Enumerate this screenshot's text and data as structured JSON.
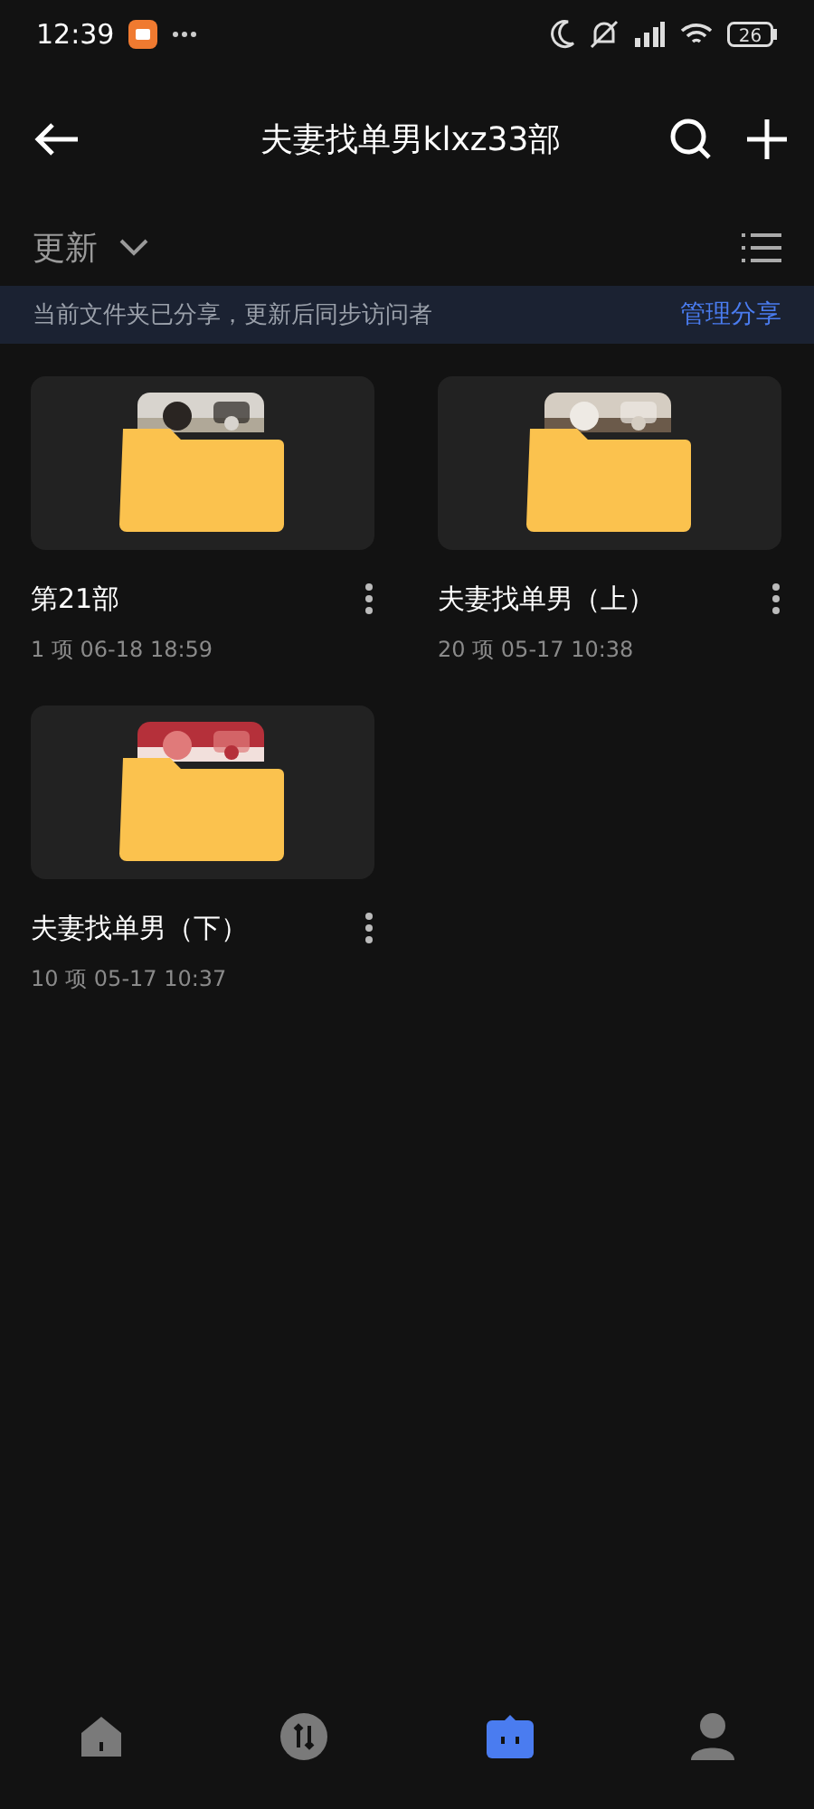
{
  "status_bar": {
    "time": "12:39",
    "battery": "26"
  },
  "header": {
    "title": "夫妻找单男klxz33部"
  },
  "sort": {
    "label": "更新"
  },
  "share_banner": {
    "message": "当前文件夹已分享，更新后同步访问者",
    "action": "管理分享"
  },
  "folders": [
    {
      "name": "第21部",
      "count": "1 项",
      "date": "06-18 18:59"
    },
    {
      "name": "夫妻找单男（上）",
      "count": "20 项",
      "date": "05-17 10:38"
    },
    {
      "name": "夫妻找单男（下）",
      "count": "10 项",
      "date": "05-17 10:37"
    }
  ],
  "nav": [
    {
      "kind": "home",
      "selected": false
    },
    {
      "kind": "transfer",
      "selected": false
    },
    {
      "kind": "files",
      "selected": true
    },
    {
      "kind": "profile",
      "selected": false
    }
  ]
}
